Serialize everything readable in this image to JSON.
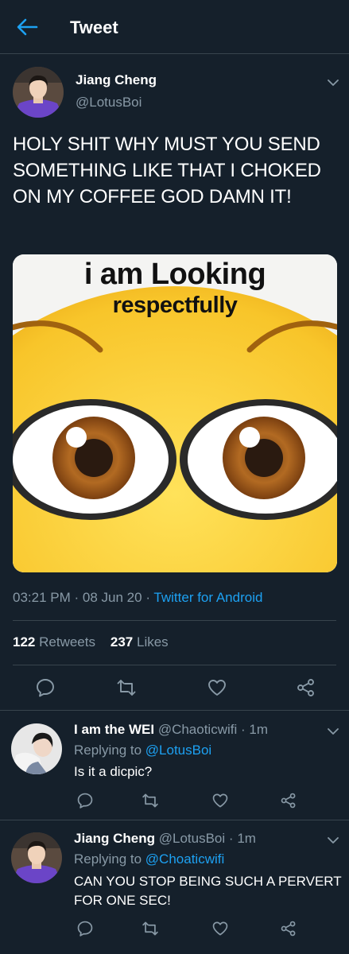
{
  "header": {
    "title": "Tweet"
  },
  "tweet": {
    "author_name": "Jiang Cheng",
    "author_handle": "@LotusBoi",
    "text": "HOLY SHIT WHY MUST YOU SEND SOMETHING LIKE THAT I CHOKED ON MY COFFEE GOD DAMN IT!",
    "media": {
      "line1": "i am Looking",
      "line2": "respectfully"
    },
    "time": "03:21 PM",
    "sep": "·",
    "date": "08 Jun 20",
    "source": "Twitter for Android",
    "retweets_count": "122",
    "retweets_label": "Retweets",
    "likes_count": "237",
    "likes_label": "Likes"
  },
  "replies": [
    {
      "name": "I am the WEI",
      "handle": "@Chaoticwifi",
      "sep": "·",
      "time": "1m",
      "replying_prefix": "Replying to",
      "replying_to": "@LotusBoi",
      "text": "Is it a dicpic?"
    },
    {
      "name": "Jiang Cheng",
      "handle": "@LotusBoi",
      "sep": "·",
      "time": "1m",
      "replying_prefix": "Replying to",
      "replying_to": "@Choaticwifi",
      "text": "CAN YOU STOP BEING SUCH A PERVERT FOR ONE SEC!"
    }
  ],
  "icons": [
    "back-arrow-icon",
    "chevron-down-icon",
    "reply-icon",
    "retweet-icon",
    "like-icon",
    "share-icon"
  ],
  "colors": {
    "background": "#15202b",
    "accent": "#1da1f2",
    "secondary_text": "#8899a6",
    "divider": "#38444d"
  }
}
